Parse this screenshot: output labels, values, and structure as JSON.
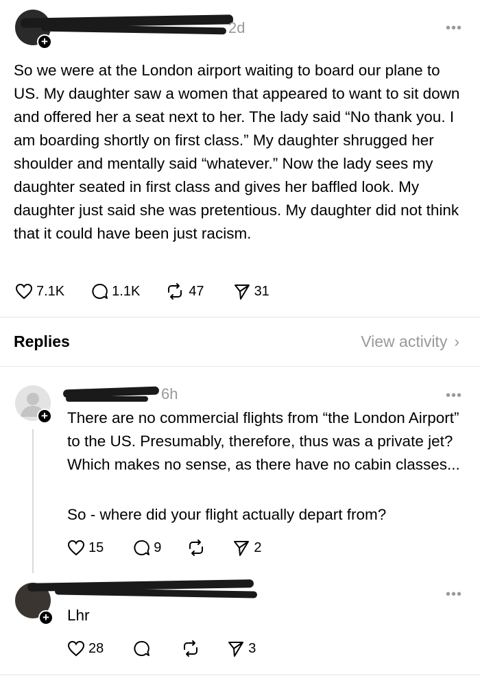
{
  "post": {
    "time": "2d",
    "body": "So we were at the London airport waiting to board our plane to US. My daughter saw a women that appeared to want to sit down and offered her a seat next to her. The lady said “No thank you. I am boarding shortly on first class.” My daughter shrugged her shoulder and mentally said “whatever.” Now the lady sees my daughter seated in first class and gives her baffled look. My daughter just said she was pretentious. My daughter did not think that it could have been just racism.",
    "likes": "7.1K",
    "comments": "1.1K",
    "reposts": "47",
    "shares": "31"
  },
  "replies_header": {
    "label": "Replies",
    "view_activity": "View activity"
  },
  "reply1": {
    "time": "6h",
    "body_line1": "There are no commercial flights from “the London Airport” to the US. Presumably, therefore, thus was a private jet? Which makes no sense, as there have no cabin classes...",
    "body_line2": "So - where did your flight actually depart from?",
    "likes": "15",
    "comments": "9",
    "reposts": "",
    "shares": "2"
  },
  "reply2": {
    "body": "Lhr",
    "likes": "28",
    "comments": "",
    "reposts": "",
    "shares": "3"
  },
  "icons": {
    "more": "•••",
    "chevron": "›",
    "plus": "+"
  }
}
